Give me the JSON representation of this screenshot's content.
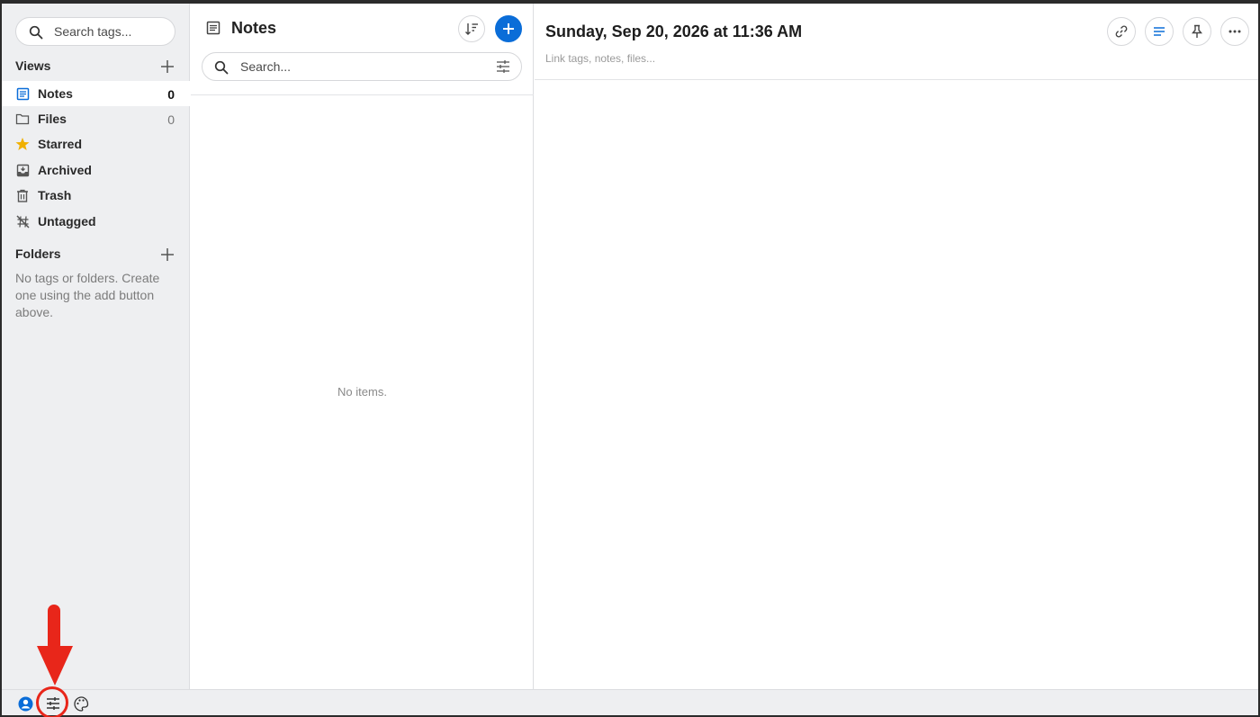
{
  "sidebar": {
    "search_placeholder": "Search tags...",
    "views_title": "Views",
    "views": [
      {
        "label": "Notes",
        "count": "0",
        "icon": "notes-icon",
        "active": true
      },
      {
        "label": "Files",
        "count": "0",
        "icon": "folder-icon"
      },
      {
        "label": "Starred",
        "count": "",
        "icon": "star-icon"
      },
      {
        "label": "Archived",
        "count": "",
        "icon": "archive-icon"
      },
      {
        "label": "Trash",
        "count": "",
        "icon": "trash-icon"
      },
      {
        "label": "Untagged",
        "count": "",
        "icon": "untagged-icon"
      }
    ],
    "folders_title": "Folders",
    "folders_empty": "No tags or folders. Create one using the add button above."
  },
  "list": {
    "title": "Notes",
    "search_placeholder": "Search...",
    "empty": "No items."
  },
  "editor": {
    "title": "Sunday, Sep 20, 2026 at 11:36 AM",
    "link_placeholder": "Link tags, notes, files..."
  },
  "footer": {
    "icons": [
      "account-icon",
      "preferences-icon",
      "themes-icon"
    ]
  },
  "colors": {
    "accent": "#0a6dd8",
    "star": "#f0b000",
    "annotation": "#e8261a"
  }
}
